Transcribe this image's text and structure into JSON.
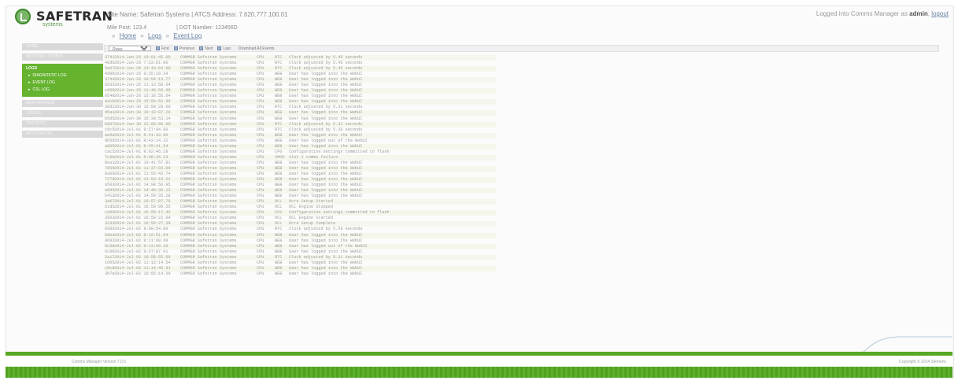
{
  "header": {
    "brand": "SAFETRAN",
    "brand_sub": "systems",
    "site_line": "Site Name: Safetran Systems | ATCS Address: 7.620.777.100.01",
    "mile_post_label": "Mile Post:",
    "mile_post_value": "123.4",
    "dot_label": "| DOT Number:",
    "dot_value": "123456D",
    "login_prefix": "Logged into Comms Manager as",
    "login_user": "admin",
    "login_sep": ",",
    "logout_label": "logout"
  },
  "breadcrumb": {
    "prefix": "»",
    "items": [
      "Home",
      "Logs",
      "Event Log"
    ],
    "separator": "»"
  },
  "sidebar": {
    "items_top": [
      "HOME",
      "MONITOR / COMMS"
    ],
    "group": {
      "title": "LOGS",
      "subitems": [
        "DIAGNOSTIC LOG",
        "EVENT LOG",
        "CSL LOG"
      ]
    },
    "items_bottom": [
      "MAINTENANCE",
      "STATUS",
      "SECURITY",
      "APPLICATION"
    ]
  },
  "toolbar": {
    "select_value": "Rows",
    "buttons": [
      "First",
      "Previous",
      "Next",
      "Last"
    ],
    "download_label": "Download All Events"
  },
  "log_rows": [
    {
      "id": "3741",
      "date": "2014-Jun-26 10:01:45.00",
      "src": "COMMGR Safetran Systems",
      "cat": "CPU",
      "type": "RTC",
      "msg": "Clock adjusted by 5.45 seconds"
    },
    {
      "id": "46d6",
      "date": "2014-Jun-26 7:33:01.00",
      "src": "COMMGR Safetran Systems",
      "cat": "CPU",
      "type": "RTC",
      "msg": "Clock adjusted by 5.45 seconds"
    },
    {
      "id": "5a67",
      "date": "2014-Jun-26 14:43:04.00",
      "src": "COMMGR Safetran Systems",
      "cat": "CPU",
      "type": "RTC",
      "msg": "Clock adjusted by 5.45 seconds"
    },
    {
      "id": "4d9b",
      "date": "2014-Jun-26 8:35:19.34",
      "src": "COMMGR Safetran Systems",
      "cat": "CPU",
      "type": "WEB",
      "msg": "User has logged into the WebUI"
    },
    {
      "id": "3744",
      "date": "2014-Jun-26 10:04:13.77",
      "src": "COMMGR Safetran Systems",
      "cat": "CPU",
      "type": "WEB",
      "msg": "User has logged into the WebUI"
    },
    {
      "id": "5632",
      "date": "2014-Jun-26 11:13:58.64",
      "src": "COMMGR Safetran Systems",
      "cat": "CPU",
      "type": "WEB",
      "msg": "User has logged into the WebUI"
    },
    {
      "id": "c959",
      "date": "2014-Jun-26 11:48:58.96",
      "src": "COMMGR Safetran Systems",
      "cat": "CPU",
      "type": "WEB",
      "msg": "User has logged into the WebUI"
    },
    {
      "id": "8549",
      "date": "2014-Jun-26 15:18:55.64",
      "src": "COMMGR Safetran Systems",
      "cat": "CPU",
      "type": "WEB",
      "msg": "User has logged into the WebUI"
    },
    {
      "id": "ea1b",
      "date": "2014-Jun-26 15:50:52.96",
      "src": "COMMGR Safetran Systems",
      "cat": "CPU",
      "type": "WEB",
      "msg": "User has logged into the WebUI"
    },
    {
      "id": "36d2",
      "date": "2014-Jun-30 16:00:28.00",
      "src": "COMMGR Safetran Systems",
      "cat": "CPU",
      "type": "RTC",
      "msg": "Clock adjusted by 5.31 seconds"
    },
    {
      "id": "d5a1",
      "date": "2014-Jun-30 16:13:07.29",
      "src": "COMMGR Safetran Systems",
      "cat": "CPU",
      "type": "WEB",
      "msg": "User has logged into the WebUI"
    },
    {
      "id": "b5d5",
      "date": "2014-Jun-30 16:30:53.14",
      "src": "COMMGR Safetran Systems",
      "cat": "CPU",
      "type": "WEB",
      "msg": "User has logged into the WebUI"
    },
    {
      "id": "b607",
      "date": "2014-Jun-30 22:00:00.00",
      "src": "COMMGR Safetran Systems",
      "cat": "CPU",
      "type": "RTC",
      "msg": "Clock adjusted by 5.32 seconds"
    },
    {
      "id": "c6c5",
      "date": "2014-Jul-01 8:27:04.00",
      "src": "COMMGR Safetran Systems",
      "cat": "CPU",
      "type": "RTC",
      "msg": "Clock adjusted by 5.36 seconds"
    },
    {
      "id": "ae9e",
      "date": "2014-Jul-01 8:41:33.00",
      "src": "COMMGR Safetran Systems",
      "cat": "CPU",
      "type": "WEB",
      "msg": "User has logged into the WebUI"
    },
    {
      "id": "9b5d",
      "date": "2014-Jul-01 8:43:14.32",
      "src": "COMMGR Safetran Systems",
      "cat": "CPU",
      "type": "WEB",
      "msg": "User has logged out of the WebUI"
    },
    {
      "id": "a065",
      "date": "2014-Jul-01 8:45:41.54",
      "src": "COMMGR Safetran Systems",
      "cat": "CPU",
      "type": "WEB",
      "msg": "User has logged into the WebUI"
    },
    {
      "id": "cac5",
      "date": "2014-Jul-01 9:02:46.28",
      "src": "COMMGR Safetran Systems",
      "cat": "CPU",
      "type": "CFG",
      "msg": "Configuration settings committed to flash"
    },
    {
      "id": "7c6b",
      "date": "2014-Jul-01 9:48:36.23",
      "src": "COMMGR Safetran Systems",
      "cat": "CPU",
      "type": "VMOD",
      "msg": "slot 2 comms failure"
    },
    {
      "id": "8ea1",
      "date": "2014-Jul-01 10:41:57.81",
      "src": "COMMGR Safetran Systems",
      "cat": "CPU",
      "type": "WEB",
      "msg": "User has logged into the WebUI"
    },
    {
      "id": "7859",
      "date": "2014-Jul-01 11:37:03.99",
      "src": "COMMGR Safetran Systems",
      "cat": "CPU",
      "type": "WEB",
      "msg": "User has logged into the WebUI"
    },
    {
      "id": "8a60",
      "date": "2014-Jul-01 11:56:43.74",
      "src": "COMMGR Safetran Systems",
      "cat": "CPU",
      "type": "WEB",
      "msg": "User has logged into the WebUI"
    },
    {
      "id": "7279",
      "date": "2014-Jul-01 13:53:18.22",
      "src": "COMMGR Safetran Systems",
      "cat": "CPU",
      "type": "WEB",
      "msg": "User has logged into the WebUI"
    },
    {
      "id": "a503",
      "date": "2014-Jul-01 14:08:56.95",
      "src": "COMMGR Safetran Systems",
      "cat": "CPU",
      "type": "WEB",
      "msg": "User has logged into the WebUI"
    },
    {
      "id": "a895",
      "date": "2014-Jul-01 14:46:36.13",
      "src": "COMMGR Safetran Systems",
      "cat": "CPU",
      "type": "WEB",
      "msg": "User has logged into the WebUI"
    },
    {
      "id": "b413",
      "date": "2014-Jul-01 14:59:35.28",
      "src": "COMMGR Safetran Systems",
      "cat": "CPU",
      "type": "WEB",
      "msg": "User has logged into the WebUI"
    },
    {
      "id": "3a67",
      "date": "2014-Jul-01 16:57:07.79",
      "src": "COMMGR Safetran Systems",
      "cat": "CPU",
      "type": "OCL",
      "msg": "Ocre Setup Started"
    },
    {
      "id": "61d5",
      "date": "2014-Jul-01 16:59:09.55",
      "src": "COMMGR Safetran Systems",
      "cat": "CPU",
      "type": "OCL",
      "msg": "OCL Engine Stopped"
    },
    {
      "id": "ca60",
      "date": "2014-Jul-01 16:59:17.42",
      "src": "COMMGR Safetran Systems",
      "cat": "CPU",
      "type": "CFG",
      "msg": "Configuration settings committed to flash"
    },
    {
      "id": "3503",
      "date": "2014-Jul-01 16:59:22.64",
      "src": "COMMGR Safetran Systems",
      "cat": "CPU",
      "type": "OCL",
      "msg": "OCL Engine Started"
    },
    {
      "id": "3233",
      "date": "2014-Jul-01 16:59:27.38",
      "src": "COMMGR Safetran Systems",
      "cat": "CPU",
      "type": "OCL",
      "msg": "Ocre Setup Complete"
    },
    {
      "id": "9586",
      "date": "2014-Jul-02 8:00:54.00",
      "src": "COMMGR Safetran Systems",
      "cat": "CPU",
      "type": "RTC",
      "msg": "Clock adjusted by 5.59 seconds"
    },
    {
      "id": "b8ea",
      "date": "2014-Jul-02 8:10:51.84",
      "src": "COMMGR Safetran Systems",
      "cat": "CPU",
      "type": "WEB",
      "msg": "User has logged into the WebUI"
    },
    {
      "id": "8682",
      "date": "2014-Jul-02 8:11:09.69",
      "src": "COMMGR Safetran Systems",
      "cat": "CPU",
      "type": "WEB",
      "msg": "User has logged into the WebUI"
    },
    {
      "id": "5c5d",
      "date": "2014-Jul-02 9:13:09.20",
      "src": "COMMGR Safetran Systems",
      "cat": "CPU",
      "type": "WEB",
      "msg": "User has logged out of the WebUI"
    },
    {
      "id": "6c8b",
      "date": "2014-Jul-02 9:37:07.91",
      "src": "COMMGR Safetran Systems",
      "cat": "CPU",
      "type": "WEB",
      "msg": "User has logged into the WebUI"
    },
    {
      "id": "5a17",
      "date": "2014-Jul-02 10:58:55.00",
      "src": "COMMGR Safetran Systems",
      "cat": "CPU",
      "type": "RTC",
      "msg": "Clock adjusted by 5.31 seconds"
    },
    {
      "id": "1605",
      "date": "2014-Jul-02 11:13:14.54",
      "src": "COMMGR Safetran Systems",
      "cat": "CPU",
      "type": "WEB",
      "msg": "User has logged into the WebUI"
    },
    {
      "id": "c9c8",
      "date": "2014-Jul-02 11:14:45.91",
      "src": "COMMGR Safetran Systems",
      "cat": "CPU",
      "type": "WEB",
      "msg": "User has logged into the WebUI"
    },
    {
      "id": "3b7e",
      "date": "2014-Jul-02 16:05:14.38",
      "src": "COMMGR Safetran Systems",
      "cat": "CPU",
      "type": "WEB",
      "msg": "User has logged into the WebUI"
    }
  ],
  "footer": {
    "version": "Comms Manager Version 7.0.5",
    "copyright": "Copyright © 2014 Siemens"
  }
}
